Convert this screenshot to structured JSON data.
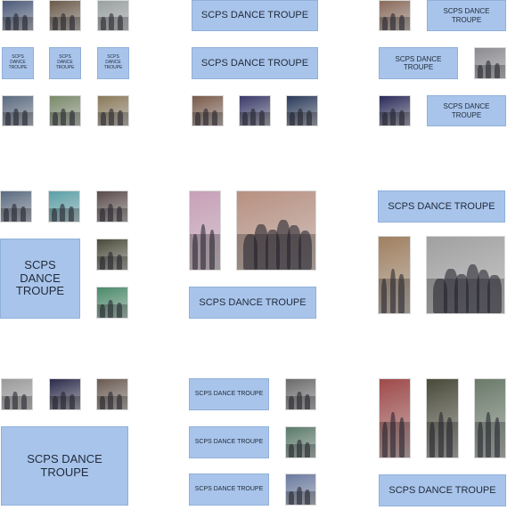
{
  "troupe_label": "SCPS DANCE TROUPE",
  "colors": {
    "label_fill": "#a9c4ea",
    "label_fill_alt": "#b4c7e7",
    "label_border": "#8fb0da"
  },
  "photos": [
    {
      "name": "photo-tl-1",
      "tone": "#4b5a7a"
    },
    {
      "name": "photo-tl-2",
      "tone": "#6b5a4a"
    },
    {
      "name": "photo-tl-3",
      "tone": "#9aa0a0"
    },
    {
      "name": "photo-tl-4",
      "tone": "#5a6a80"
    },
    {
      "name": "photo-tl-5",
      "tone": "#7a8a6a"
    },
    {
      "name": "photo-tl-6",
      "tone": "#8a7a5a"
    },
    {
      "name": "photo-tc-1",
      "tone": "#7a5a4a"
    },
    {
      "name": "photo-tc-2",
      "tone": "#3a3a6a"
    },
    {
      "name": "photo-tc-3",
      "tone": "#2a3a5a"
    },
    {
      "name": "photo-tr-1",
      "tone": "#8a6a5a"
    },
    {
      "name": "photo-tr-2",
      "tone": "#8a8a90"
    },
    {
      "name": "photo-tr-3",
      "tone": "#2a2a5a"
    },
    {
      "name": "photo-ml-1",
      "tone": "#5a6a80"
    },
    {
      "name": "photo-ml-2",
      "tone": "#5aa0a8"
    },
    {
      "name": "photo-ml-3",
      "tone": "#5a4a4a"
    },
    {
      "name": "photo-ml-4",
      "tone": "#4a4a3a"
    },
    {
      "name": "photo-ml-5",
      "tone": "#4a8a6a"
    },
    {
      "name": "photo-mc-strip",
      "tone": "#c8a0b8"
    },
    {
      "name": "photo-mc-group",
      "tone": "#b89080"
    },
    {
      "name": "photo-mr-1",
      "tone": "#a08060"
    },
    {
      "name": "photo-mr-2",
      "tone": "#a0a0a0"
    },
    {
      "name": "photo-bl-1",
      "tone": "#9a9a9a"
    },
    {
      "name": "photo-bl-2",
      "tone": "#2a2a4a"
    },
    {
      "name": "photo-bl-3",
      "tone": "#6a5a50"
    },
    {
      "name": "photo-bc-1",
      "tone": "#6a6a6a"
    },
    {
      "name": "photo-bc-2",
      "tone": "#5a7a6a"
    },
    {
      "name": "photo-bc-3",
      "tone": "#6a7aa0"
    },
    {
      "name": "photo-br-1",
      "tone": "#a04a4a"
    },
    {
      "name": "photo-br-2",
      "tone": "#4a4a3a"
    },
    {
      "name": "photo-br-3",
      "tone": "#6a7a6a"
    }
  ]
}
